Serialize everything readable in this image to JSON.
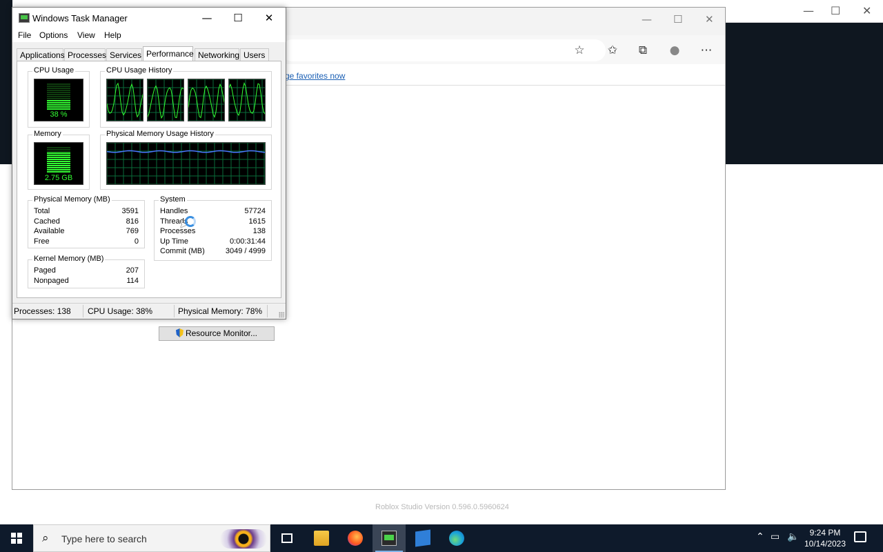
{
  "background_windows": {
    "edge": {
      "favorites_link": "ge favorites now",
      "toolbar_icons": [
        "add-favorite-icon",
        "favorites-icon",
        "collections-icon",
        "profile-icon",
        "more-icon"
      ]
    },
    "roblox_version": "Roblox Studio Version 0.596.0.5960624"
  },
  "task_manager": {
    "title": "Windows Task Manager",
    "menu": [
      "File",
      "Options",
      "View",
      "Help"
    ],
    "tabs": [
      "Applications",
      "Processes",
      "Services",
      "Performance",
      "Networking",
      "Users"
    ],
    "active_tab": "Performance",
    "cpu_usage": {
      "label": "CPU Usage",
      "value_text": "38 %",
      "level": 0.38
    },
    "cpu_history": {
      "label": "CPU Usage History",
      "cores": 4
    },
    "memory": {
      "label": "Memory",
      "value_text": "2.75 GB",
      "level": 0.78
    },
    "memory_history": {
      "label": "Physical Memory Usage History"
    },
    "physical_memory": {
      "label": "Physical Memory (MB)",
      "rows": [
        {
          "label": "Total",
          "value": "3591"
        },
        {
          "label": "Cached",
          "value": "816"
        },
        {
          "label": "Available",
          "value": "769"
        },
        {
          "label": "Free",
          "value": "0"
        }
      ]
    },
    "kernel_memory": {
      "label": "Kernel Memory (MB)",
      "rows": [
        {
          "label": "Paged",
          "value": "207"
        },
        {
          "label": "Nonpaged",
          "value": "114"
        }
      ]
    },
    "system": {
      "label": "System",
      "rows": [
        {
          "label": "Handles",
          "value": "57724"
        },
        {
          "label": "Threads",
          "value": "1615"
        },
        {
          "label": "Processes",
          "value": "138"
        },
        {
          "label": "Up Time",
          "value": "0:00:31:44"
        },
        {
          "label": "Commit (MB)",
          "value": "3049 / 4999"
        }
      ]
    },
    "resource_monitor_button": "Resource Monitor...",
    "status": {
      "processes": "Processes: 138",
      "cpu": "CPU Usage: 38%",
      "memory": "Physical Memory: 78%"
    }
  },
  "taskbar": {
    "search_placeholder": "Type here to search",
    "apps": [
      "task-view",
      "file-explorer",
      "firefox",
      "task-manager",
      "roblox-studio",
      "edge"
    ],
    "active_app": "task-manager",
    "time": "9:24 PM",
    "date": "10/14/2023"
  },
  "colors": {
    "graph_green": "#33ff33",
    "memory_line": "#4a78ff",
    "taskbar": "#0e1a2b"
  }
}
